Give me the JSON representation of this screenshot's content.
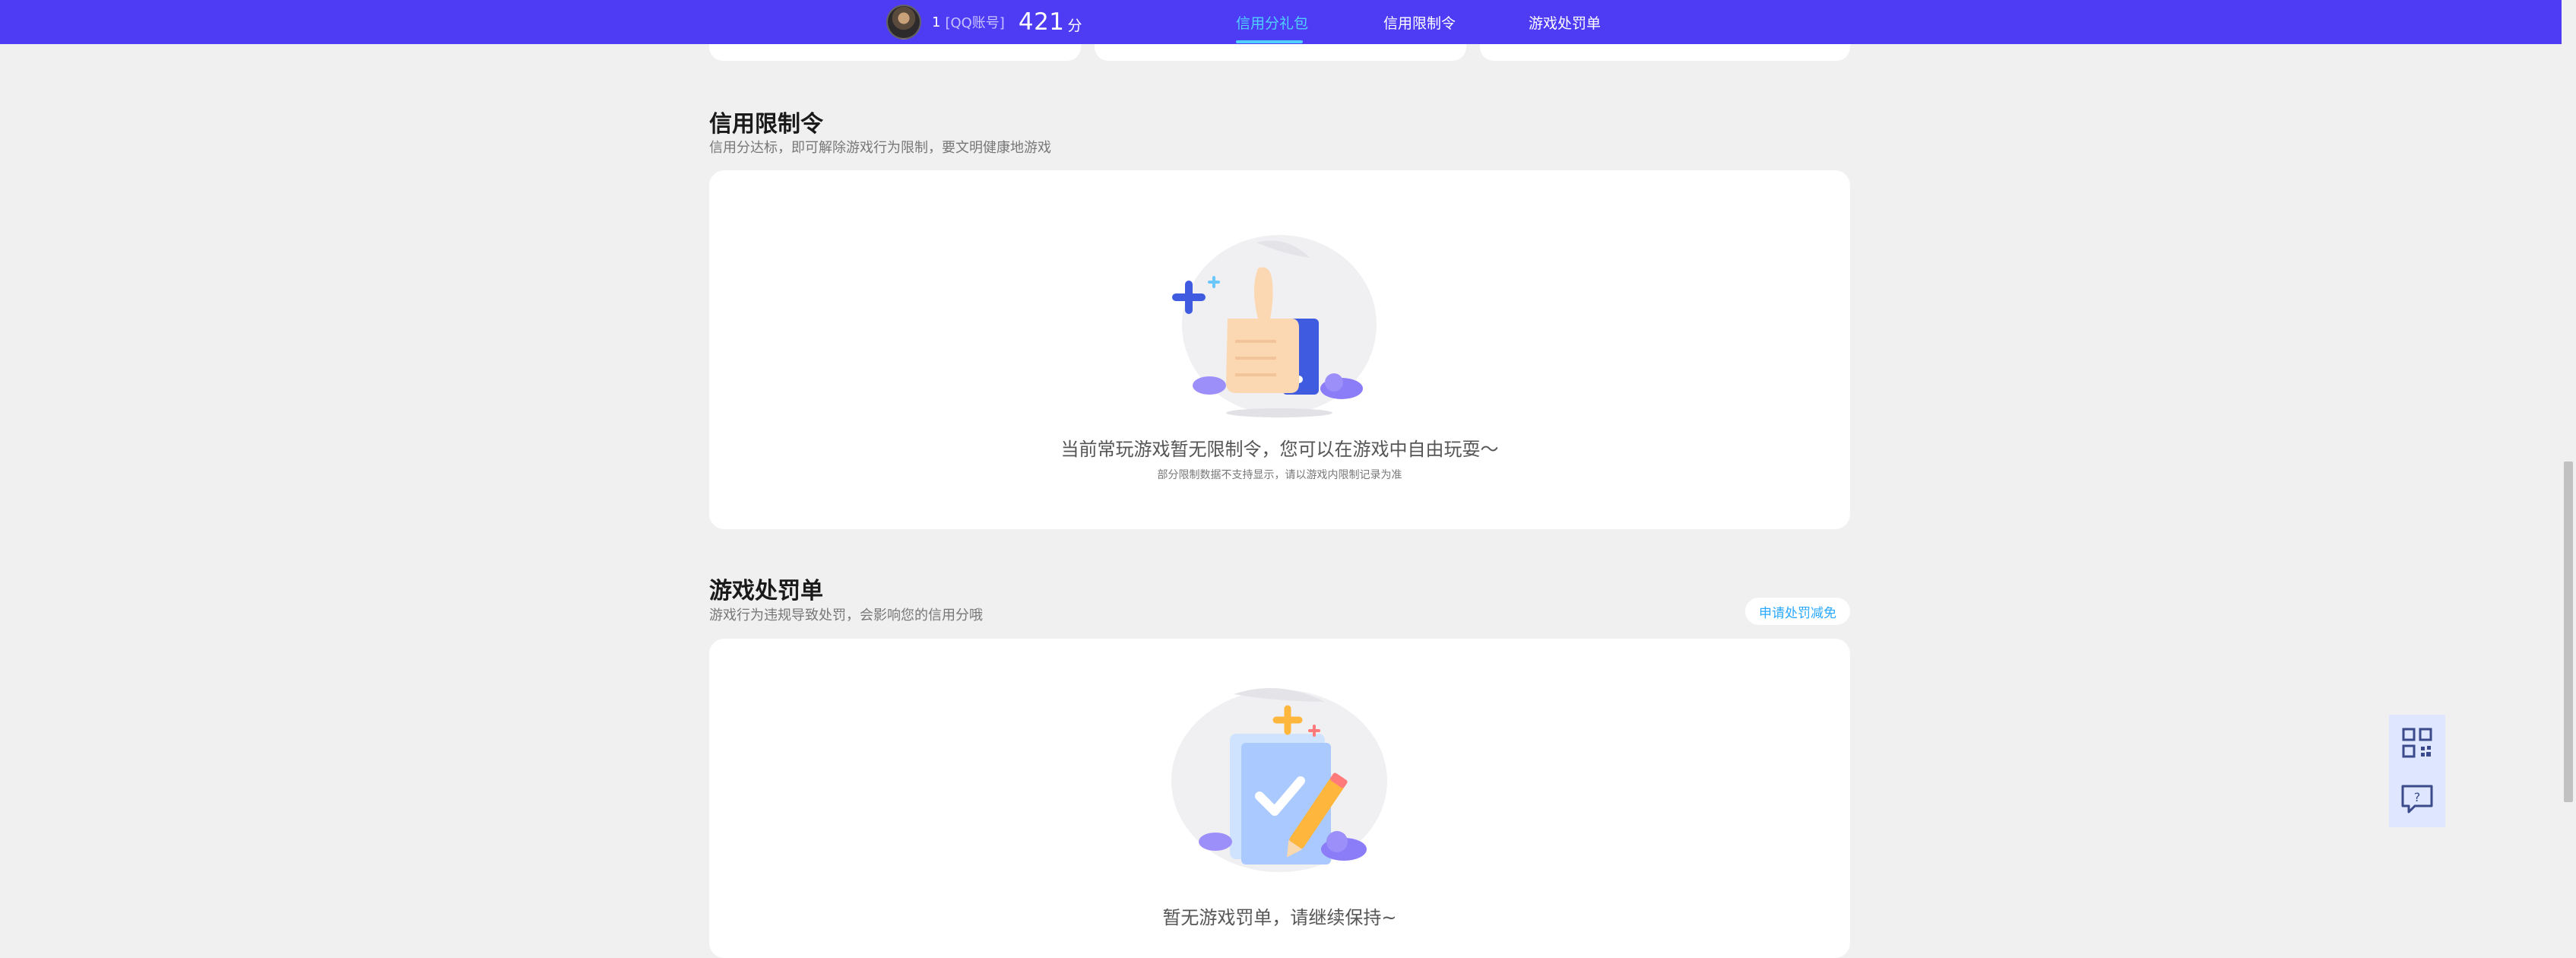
{
  "header": {
    "user_id": "1",
    "account_tag": "[QQ账号]",
    "score": "421",
    "score_unit": "分",
    "nav": [
      {
        "label": "信用分礼包",
        "active": true
      },
      {
        "label": "信用限制令",
        "active": false
      },
      {
        "label": "游戏处罚单",
        "active": false
      }
    ]
  },
  "restriction": {
    "title": "信用限制令",
    "desc": "信用分达标，即可解除游戏行为限制，要文明健康地游戏",
    "empty_main": "当前常玩游戏暂无限制令，您可以在游戏中自由玩耍～",
    "empty_sub": "部分限制数据不支持显示，请以游戏内限制记录为准",
    "icon": "thumbs-up-illustration"
  },
  "penalty": {
    "title": "游戏处罚单",
    "desc": "游戏行为违规导致处罚，会影响您的信用分哦",
    "apply_button": "申请处罚减免",
    "empty_main": "暂无游戏罚单，请继续保持~",
    "icon": "clipboard-check-illustration"
  },
  "floating": {
    "qr_icon": "qr-code-icon",
    "help_icon": "help-chat-icon"
  },
  "colors": {
    "brand": "#4e3cf5",
    "accent": "#4fd1ff",
    "link": "#2aa8ff"
  }
}
